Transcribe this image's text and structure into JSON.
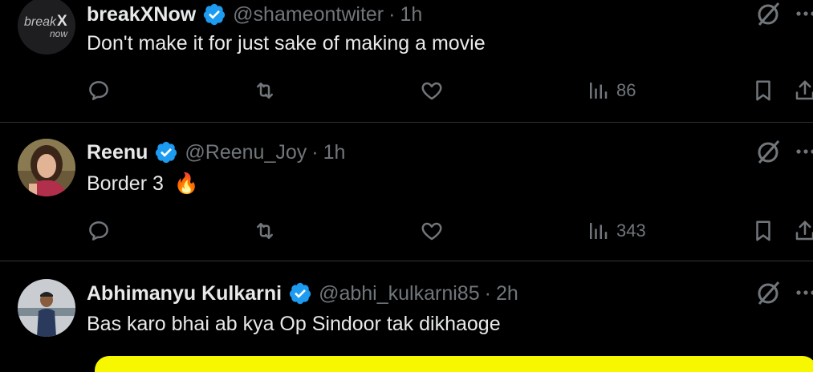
{
  "tweets": [
    {
      "name": "breakXNow",
      "handle": "@shameontwiter",
      "time": "1h",
      "text": "Don't make it for just sake of making a movie",
      "avatar_text": "breakX now",
      "views": "86"
    },
    {
      "name": "Reenu",
      "handle": "@Reenu_Joy",
      "time": "1h",
      "text": "Border 3",
      "emoji": "🔥",
      "views": "343"
    },
    {
      "name": "Abhimanyu Kulkarni",
      "handle": "@abhi_kulkarni85",
      "time": "2h",
      "text": "Bas karo bhai ab kya Op Sindoor tak dikhaoge"
    }
  ],
  "separator": "·",
  "icons": [
    "verified-badge-icon",
    "grok-icon",
    "more-icon",
    "reply-icon",
    "retweet-icon",
    "like-icon",
    "views-icon",
    "bookmark-icon",
    "share-icon"
  ],
  "colors": {
    "background": "#000000",
    "text": "#e7e9ea",
    "muted": "#71767b",
    "verified": "#1d9bf0",
    "divider": "#2f3336",
    "media_preview": "#f7f700"
  }
}
